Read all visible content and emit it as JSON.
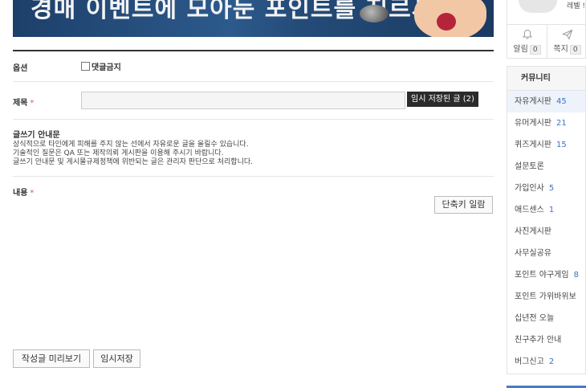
{
  "banner": {
    "text": "경매 이벤트에 모아둔 포인트를 지르세요!"
  },
  "form": {
    "option_label": "옵션",
    "no_comment_label": "댓글금지",
    "title_label": "제목",
    "required_mark": "*",
    "title_value": "",
    "temp_saved_button": "임시 저장된 글 (2)",
    "guide_title": "글쓰기 안내문",
    "guide_lines": [
      "상식적으로 타인에게 피해를 주지 않는 선에서 자유로운 글을 올릴수 있습니다.",
      "기술적인 질문은 QA 또는 제작의뢰 게시판을 이용해 주시기 바랍니다.",
      "글쓰기 안내문 및 게시물규제정책에 위반되는 글은 관리자 판단으로 처리합니다."
    ],
    "content_label": "내용",
    "shortcut_button": "단축키 일람",
    "preview_button": "작성글 미리보기",
    "save_draft_button": "임시저장"
  },
  "sidebar": {
    "level_text": "레벨 !",
    "notify_label": "알림",
    "notify_count": "0",
    "message_label": "쪽지",
    "message_count": "0",
    "community_title": "커뮤니티",
    "items": [
      {
        "label": "자유게시판",
        "count": "45",
        "active": true
      },
      {
        "label": "유머게시판",
        "count": "21"
      },
      {
        "label": "퀴즈게시판",
        "count": "15"
      },
      {
        "label": "설문토론",
        "count": ""
      },
      {
        "label": "가입인사",
        "count": "5"
      },
      {
        "label": "애드센스",
        "count": "1"
      },
      {
        "label": "사진게시판",
        "count": ""
      },
      {
        "label": "사무실공유",
        "count": ""
      },
      {
        "label": "포인트 야구게임",
        "count": "8"
      },
      {
        "label": "포인트 가위바위보",
        "count": ""
      },
      {
        "label": "십년전 오늘",
        "count": ""
      },
      {
        "label": "친구추가 안내",
        "count": ""
      },
      {
        "label": "버그신고",
        "count": "2"
      }
    ]
  },
  "colors": {
    "accent": "#3b73c8",
    "required": "#e05a4a",
    "dark_button": "#2b2b2b"
  }
}
